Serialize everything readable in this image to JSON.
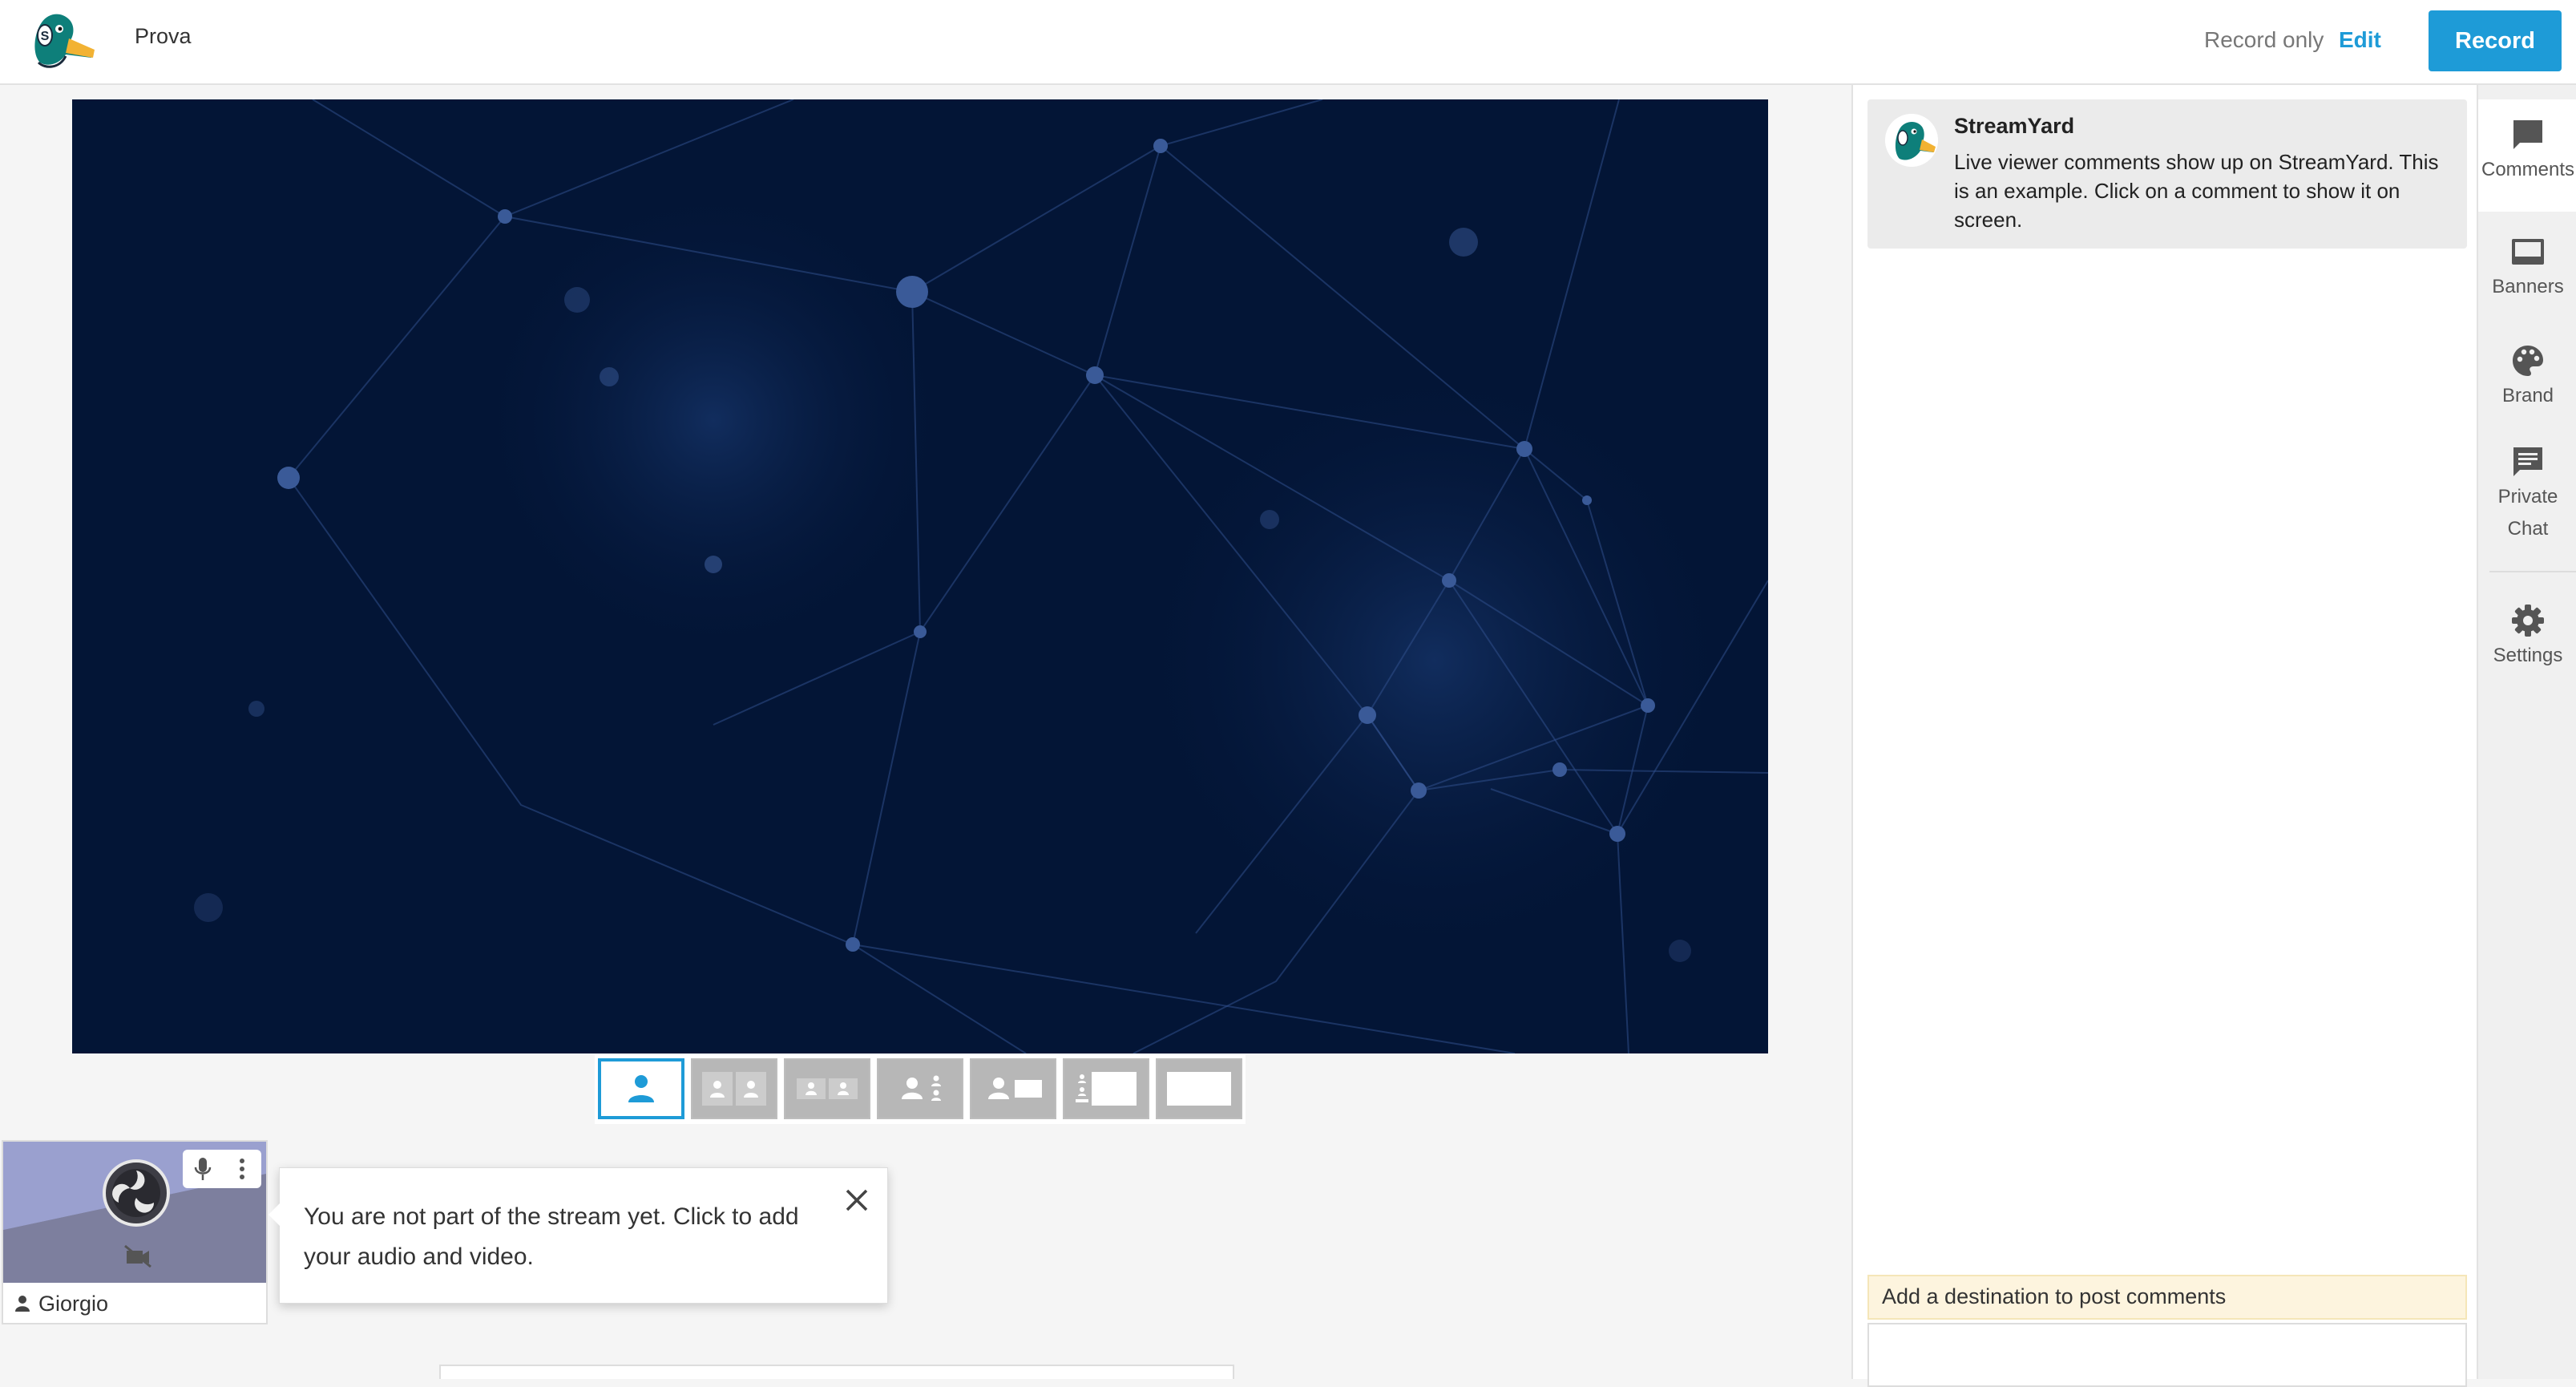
{
  "header": {
    "broadcast_title": "Prova",
    "record_only_label": "Record only",
    "edit_label": "Edit",
    "record_button_label": "Record"
  },
  "layouts": [
    {
      "name": "solo",
      "active": true
    },
    {
      "name": "thin"
    },
    {
      "name": "group"
    },
    {
      "name": "leader"
    },
    {
      "name": "news"
    },
    {
      "name": "thin-screen"
    },
    {
      "name": "fullscreen"
    }
  ],
  "participant": {
    "name": "Giorgio"
  },
  "tooltip": {
    "text": "You are not part of the stream yet. Click to add your audio and video."
  },
  "comments": {
    "items": [
      {
        "author": "StreamYard",
        "text": "Live viewer comments show up on StreamYard. This is an example. Click on a comment to show it on screen."
      }
    ],
    "destination_notice": "Add a destination to post comments"
  },
  "rail": [
    {
      "label": "Comments",
      "icon": "comment-icon",
      "active": true
    },
    {
      "label": "Banners",
      "icon": "banner-icon"
    },
    {
      "label": "Brand",
      "icon": "palette-icon"
    },
    {
      "label": "Private Chat",
      "icon": "chat-icon"
    },
    {
      "label": "Settings",
      "icon": "gear-icon"
    }
  ],
  "colors": {
    "accent": "#1e9bd7",
    "stage_background": "#031536",
    "notice_background": "#fdf4de"
  }
}
